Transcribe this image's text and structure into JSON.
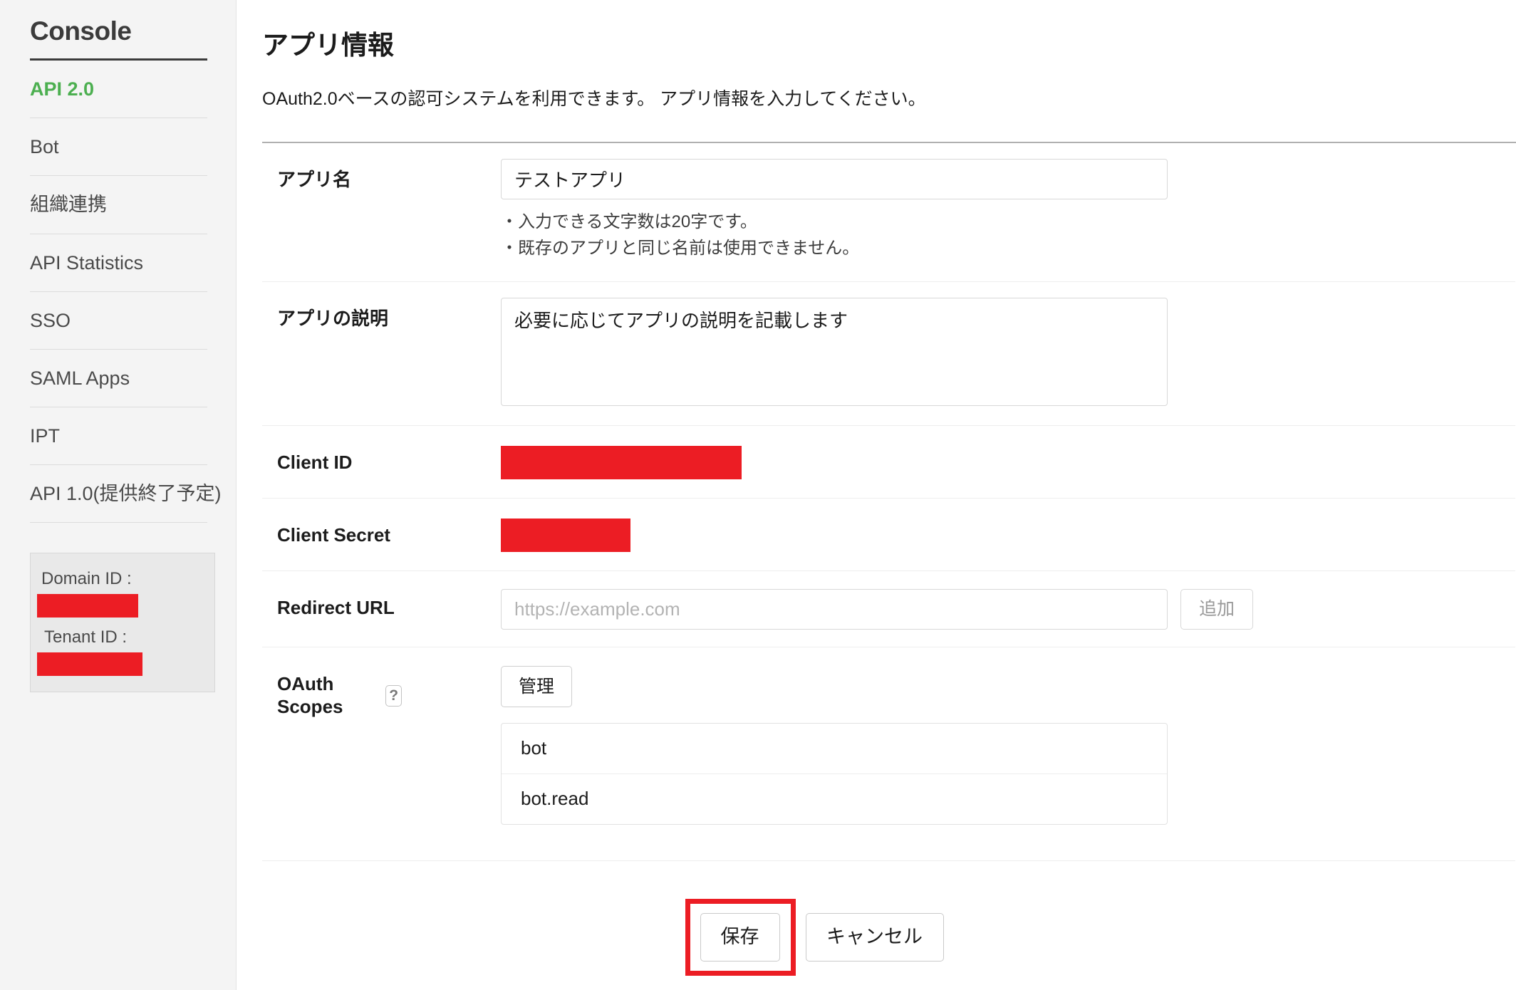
{
  "sidebar": {
    "title": "Console",
    "items": [
      {
        "label": "API 2.0",
        "active": true
      },
      {
        "label": "Bot",
        "active": false
      },
      {
        "label": "組織連携",
        "active": false
      },
      {
        "label": "API Statistics",
        "active": false
      },
      {
        "label": "SSO",
        "active": false
      },
      {
        "label": "SAML Apps",
        "active": false
      },
      {
        "label": "IPT",
        "active": false
      },
      {
        "label": "API 1.0(提供終了予定)",
        "active": false
      }
    ],
    "id_box": {
      "domain_label": "Domain ID :",
      "domain_value": "",
      "tenant_label": "Tenant ID :",
      "tenant_value": ""
    }
  },
  "main": {
    "title": "アプリ情報",
    "description": "OAuth2.0ベースの認可システムを利用できます。 アプリ情報を入力してください。",
    "fields": {
      "app_name": {
        "label": "アプリ名",
        "value": "テストアプリ",
        "placeholder": "",
        "hints": [
          "・入力できる文字数は20字です。",
          "・既存のアプリと同じ名前は使用できません。"
        ]
      },
      "app_description": {
        "label": "アプリの説明",
        "value": "必要に応じてアプリの説明を記載します",
        "placeholder": ""
      },
      "client_id": {
        "label": "Client ID",
        "value": ""
      },
      "client_secret": {
        "label": "Client Secret",
        "value": ""
      },
      "redirect_url": {
        "label": "Redirect URL",
        "value": "",
        "placeholder": "https://example.com",
        "add_button": "追加"
      },
      "oauth_scopes": {
        "label": "OAuth Scopes",
        "help_icon": "question-mark-icon",
        "manage_button": "管理",
        "scopes": [
          "bot",
          "bot.read"
        ]
      }
    },
    "actions": {
      "save": "保存",
      "cancel": "キャンセル"
    }
  },
  "colors": {
    "accent_green": "#4CAF50",
    "redaction_red": "#EC1D24",
    "highlight_red": "#EC1D24",
    "sidebar_bg": "#F4F4F4"
  }
}
